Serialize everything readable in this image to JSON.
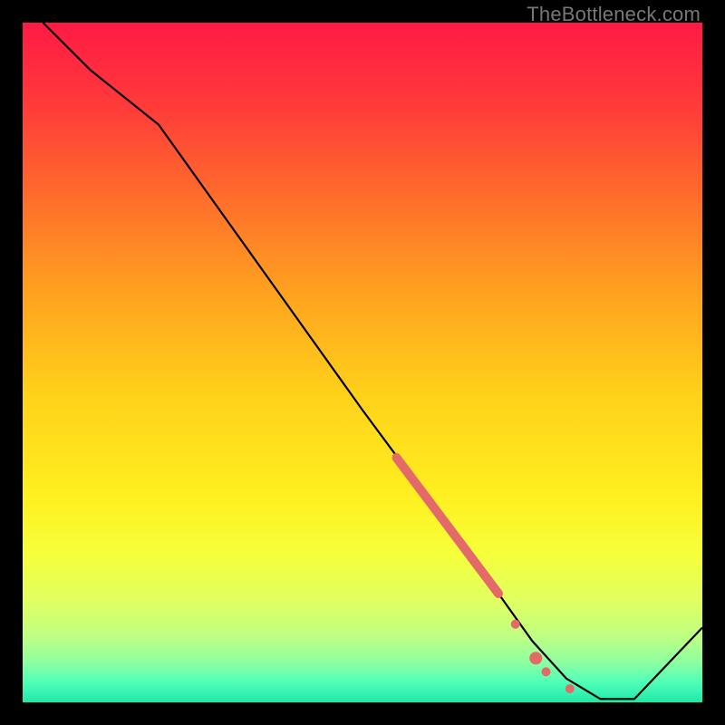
{
  "watermark": "TheBottleneck.com",
  "gradient": {
    "stops": [
      {
        "offset": 0.0,
        "color": "#ff1a45"
      },
      {
        "offset": 0.12,
        "color": "#ff3a3a"
      },
      {
        "offset": 0.25,
        "color": "#ff6a2c"
      },
      {
        "offset": 0.4,
        "color": "#ffa31f"
      },
      {
        "offset": 0.55,
        "color": "#ffd21a"
      },
      {
        "offset": 0.7,
        "color": "#fff020"
      },
      {
        "offset": 0.78,
        "color": "#f6ff3a"
      },
      {
        "offset": 0.85,
        "color": "#e1ff60"
      },
      {
        "offset": 0.9,
        "color": "#c0ff80"
      },
      {
        "offset": 0.94,
        "color": "#90ffa0"
      },
      {
        "offset": 0.97,
        "color": "#50ffb8"
      },
      {
        "offset": 1.0,
        "color": "#20e8a8"
      }
    ]
  },
  "chart_data": {
    "type": "line",
    "title": "",
    "xlabel": "",
    "ylabel": "",
    "xlim": [
      0,
      100
    ],
    "ylim": [
      0,
      100
    ],
    "series": [
      {
        "name": "bottleneck-curve",
        "x": [
          3,
          10,
          20,
          30,
          40,
          50,
          60,
          70,
          75,
          80,
          85,
          90,
          100
        ],
        "y": [
          100,
          93,
          85,
          71,
          57,
          43,
          29.5,
          16,
          9,
          3.5,
          0.5,
          0.5,
          11
        ]
      }
    ],
    "highlight_segment": {
      "x": [
        55,
        70
      ],
      "y": [
        36,
        16
      ],
      "color": "#e46a6a",
      "width": 10
    },
    "highlight_points": [
      {
        "x": 72.5,
        "y": 11.5,
        "r": 5,
        "color": "#e46a6a"
      },
      {
        "x": 75.5,
        "y": 6.5,
        "r": 7,
        "color": "#e46a6a"
      },
      {
        "x": 77.0,
        "y": 4.5,
        "r": 5,
        "color": "#e46a6a"
      },
      {
        "x": 80.5,
        "y": 2.0,
        "r": 5,
        "color": "#e46a6a"
      }
    ]
  }
}
